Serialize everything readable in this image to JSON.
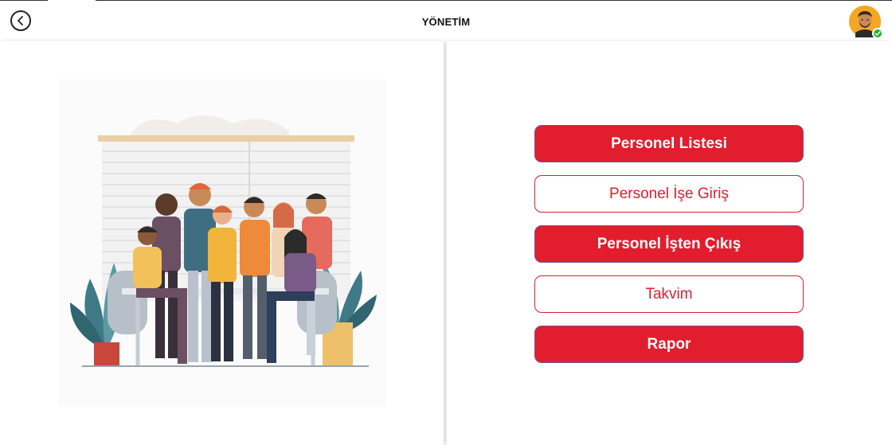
{
  "header": {
    "title": "YÖNETİM"
  },
  "icons": {
    "back": "chevron-left-circle-icon",
    "avatar": "user-avatar",
    "status": "online-check-icon"
  },
  "illustration": {
    "alt": "team-illustration"
  },
  "menu": {
    "items": [
      {
        "label": "Personel Listesi",
        "style": "filled"
      },
      {
        "label": "Personel İşe Giriş",
        "style": "outline"
      },
      {
        "label": "Personel İşten Çıkış",
        "style": "filled"
      },
      {
        "label": "Takvim",
        "style": "outline"
      },
      {
        "label": "Rapor",
        "style": "filled"
      }
    ]
  },
  "colors": {
    "accent": "#e21d2d",
    "status_online": "#1db33a"
  }
}
